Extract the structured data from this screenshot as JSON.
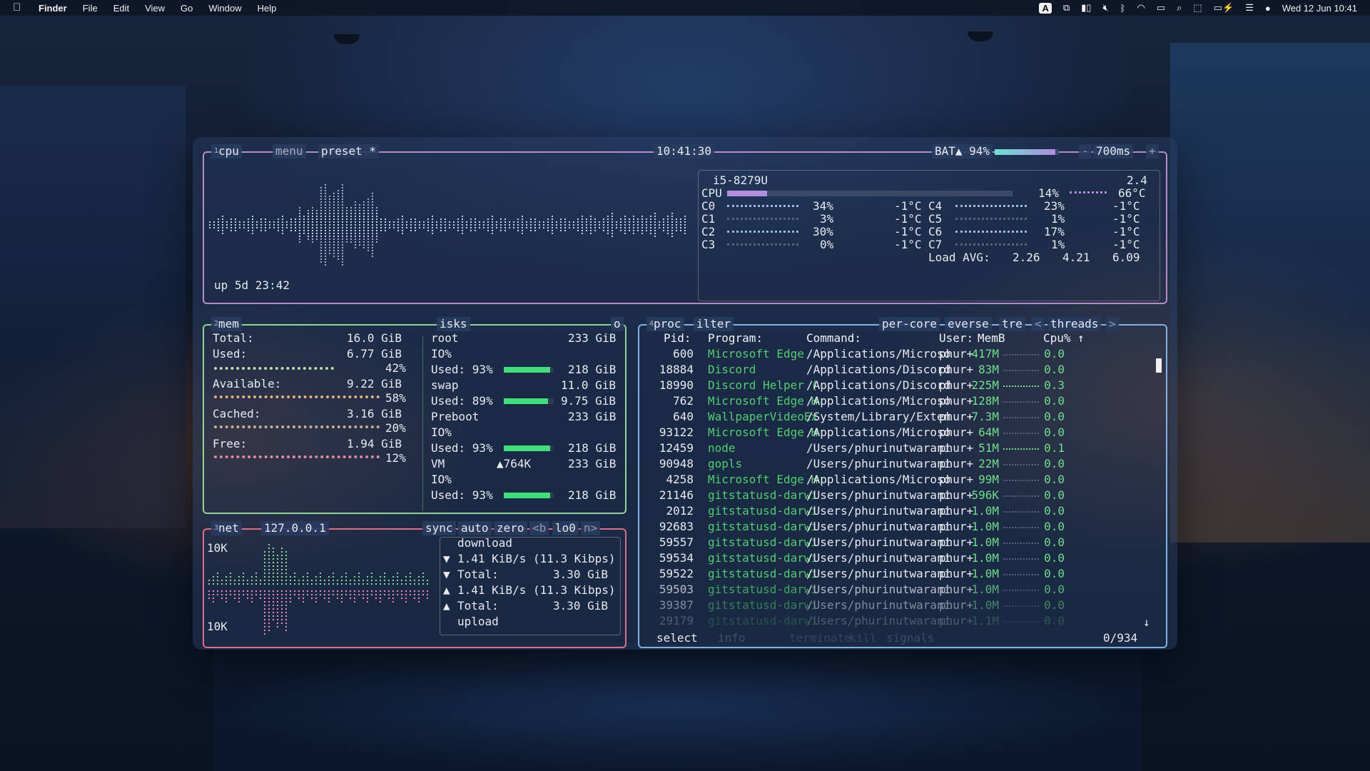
{
  "menubar": {
    "app": "Finder",
    "items": [
      "File",
      "Edit",
      "View",
      "Go",
      "Window",
      "Help"
    ],
    "status_icons": [
      "input-source-a",
      "screen-mirror-icon",
      "sidebar-icon",
      "mute-icon",
      "bluetooth-icon",
      "wifi-icon",
      "display-icon",
      "spotlight-icon",
      "bracket-icon",
      "battery-icon",
      "control-center-icon",
      "siri-icon"
    ],
    "input_source": "A",
    "clock": "Wed 12 Jun  10:41"
  },
  "cpu": {
    "tab_num": "1",
    "label": "cpu",
    "menu": "menu",
    "preset": "preset *",
    "time": "10:41:30",
    "battery": "BAT▲ 94%",
    "battery_pct": 0.94,
    "interval": "700ms",
    "minus": "-",
    "plus": "+",
    "uptime": "up 5d 23:42",
    "model": "i5-8279U",
    "freq": "2.4",
    "cpu_label": "CPU",
    "cpu_pct_text": "14%",
    "cpu_pct": 0.14,
    "cpu_temp": "66°C",
    "cores": [
      {
        "name": "C0",
        "pct": "34%",
        "temp": "-1°C"
      },
      {
        "name": "C1",
        "pct": "3%",
        "temp": "-1°C"
      },
      {
        "name": "C2",
        "pct": "30%",
        "temp": "-1°C"
      },
      {
        "name": "C3",
        "pct": "0%",
        "temp": "-1°C"
      },
      {
        "name": "C4",
        "pct": "23%",
        "temp": "-1°C"
      },
      {
        "name": "C5",
        "pct": "1%",
        "temp": "-1°C"
      },
      {
        "name": "C6",
        "pct": "17%",
        "temp": "-1°C"
      },
      {
        "name": "C7",
        "pct": "1%",
        "temp": "-1°C"
      }
    ],
    "load_label": "Load AVG:",
    "load": [
      "2.26",
      "4.21",
      "6.09"
    ]
  },
  "mem": {
    "tab_num": "2",
    "label": "mem",
    "rows": [
      {
        "label": "Total:",
        "value": "16.0 GiB"
      },
      {
        "label": "Used:",
        "value": "6.77 GiB",
        "pct": "42%"
      },
      {
        "label": "Available:",
        "value": "9.22 GiB",
        "pct": "58%"
      },
      {
        "label": "Cached:",
        "value": "3.16 GiB",
        "pct": "20%"
      },
      {
        "label": "Free:",
        "value": "1.94 GiB",
        "pct": "12%"
      }
    ],
    "used_frac": 0.42,
    "avail_frac": 0.58,
    "cached_frac": 0.2,
    "free_frac": 0.12
  },
  "disks": {
    "label": "isks",
    "io": "o",
    "rows": [
      {
        "name": "root",
        "size": "233 GiB"
      },
      {
        "name": "IO%",
        "size": ""
      },
      {
        "name": "Used: 93%",
        "size": "218 GiB",
        "frac": 0.93
      },
      {
        "name": "swap",
        "size": "11.0 GiB"
      },
      {
        "name": "Used: 89%",
        "size": "9.75 GiB",
        "frac": 0.89
      },
      {
        "name": "Preboot",
        "size": "233 GiB"
      },
      {
        "name": "IO%",
        "size": ""
      },
      {
        "name": "Used: 93%",
        "size": "218 GiB",
        "frac": 0.93
      },
      {
        "name": "VM",
        "extra": "▲764K",
        "size": "233 GiB"
      },
      {
        "name": "IO%",
        "size": ""
      },
      {
        "name": "Used: 93%",
        "size": "218 GiB",
        "frac": 0.93
      }
    ]
  },
  "net": {
    "tab_num": "3",
    "label": "net",
    "iface": "127.0.0.1",
    "sync": "sync",
    "auto": "auto",
    "zero": "zero",
    "prev": "<b",
    "if_name": "lo0",
    "next": "n>",
    "scale_top": "10K",
    "scale_bottom": "10K",
    "download": "download",
    "rows": [
      {
        "arrow": "▼",
        "text": "1.41 KiB/s (11.3 Kibps)"
      },
      {
        "arrow": "▼",
        "text": "Total:",
        "value": "3.30 GiB"
      },
      {
        "arrow": "▲",
        "text": "1.41 KiB/s (11.3 Kibps)"
      },
      {
        "arrow": "▲",
        "text": "Total:",
        "value": "3.30 GiB"
      }
    ],
    "upload": "upload"
  },
  "proc": {
    "tab_num": "4",
    "label": "proc",
    "filter": "ilter",
    "per_core": "per-core",
    "reverse": "everse",
    "tree": "tre",
    "threads": "threads",
    "lt": "<",
    "gt": ">",
    "headers": {
      "pid": "Pid:",
      "program": "Program:",
      "command": "Command:",
      "user": "User:",
      "mem": "MemB",
      "cpu": "Cpu%"
    },
    "up_arrow": "↑",
    "down_arrow": "↓",
    "rows": [
      {
        "pid": "600",
        "program": "Microsoft Edge",
        "command": "/Applications/Microso",
        "user": "phur+",
        "mem": "417M",
        "cpu": "0.0"
      },
      {
        "pid": "18884",
        "program": "Discord",
        "command": "/Applications/Discord",
        "user": "phur+",
        "mem": "83M",
        "cpu": "0.0"
      },
      {
        "pid": "18990",
        "program": "Discord Helper (",
        "command": "/Applications/Discord",
        "user": "phur+",
        "mem": "225M",
        "cpu": "0.3"
      },
      {
        "pid": "762",
        "program": "Microsoft Edge H",
        "command": "/Applications/Microso",
        "user": "phur+",
        "mem": "128M",
        "cpu": "0.0"
      },
      {
        "pid": "640",
        "program": "WallpaperVideoEx",
        "command": "/System/Library/Exten",
        "user": "phur+",
        "mem": "7.3M",
        "cpu": "0.0"
      },
      {
        "pid": "93122",
        "program": "Microsoft Edge H",
        "command": "/Applications/Microso",
        "user": "phur+",
        "mem": "64M",
        "cpu": "0.0"
      },
      {
        "pid": "12459",
        "program": "node",
        "command": "/Users/phurinutwarani",
        "user": "phur+",
        "mem": "51M",
        "cpu": "0.1"
      },
      {
        "pid": "90948",
        "program": "gopls",
        "command": "/Users/phurinutwarani",
        "user": "phur+",
        "mem": "22M",
        "cpu": "0.0"
      },
      {
        "pid": "4258",
        "program": "Microsoft Edge H",
        "command": "/Applications/Microso",
        "user": "phur+",
        "mem": "99M",
        "cpu": "0.0"
      },
      {
        "pid": "21146",
        "program": "gitstatusd-darwi",
        "command": "/Users/phurinutwarani",
        "user": "phur+",
        "mem": "596K",
        "cpu": "0.0"
      },
      {
        "pid": "2012",
        "program": "gitstatusd-darwi",
        "command": "/Users/phurinutwarani",
        "user": "phur+",
        "mem": "1.0M",
        "cpu": "0.0"
      },
      {
        "pid": "92683",
        "program": "gitstatusd-darwi",
        "command": "/Users/phurinutwarani",
        "user": "phur+",
        "mem": "1.0M",
        "cpu": "0.0"
      },
      {
        "pid": "59557",
        "program": "gitstatusd-darwi",
        "command": "/Users/phurinutwarani",
        "user": "phur+",
        "mem": "1.0M",
        "cpu": "0.0"
      },
      {
        "pid": "59534",
        "program": "gitstatusd-darwi",
        "command": "/Users/phurinutwarani",
        "user": "phur+",
        "mem": "1.0M",
        "cpu": "0.0"
      },
      {
        "pid": "59522",
        "program": "gitstatusd-darwi",
        "command": "/Users/phurinutwarani",
        "user": "phur+",
        "mem": "1.0M",
        "cpu": "0.0"
      },
      {
        "pid": "59503",
        "program": "gitstatusd-darwi",
        "command": "/Users/phurinutwarani",
        "user": "phur+",
        "mem": "1.0M",
        "cpu": "0.0"
      },
      {
        "pid": "39387",
        "program": "gitstatusd-darwi",
        "command": "/Users/phurinutwarani",
        "user": "phur+",
        "mem": "1.0M",
        "cpu": "0.0"
      },
      {
        "pid": "29179",
        "program": "gitstatusd-darwi",
        "command": "/Users/phurinutwarani",
        "user": "phur+",
        "mem": "1.1M",
        "cpu": "0.0"
      }
    ],
    "footer": {
      "select": "select",
      "info": "info",
      "terminate": "terminate",
      "kill": "kill",
      "signals": "signals",
      "count": "0/934"
    }
  },
  "colors": {
    "cpu_border": "#b98ac9",
    "mem_border": "#8fd694",
    "net_border": "#e06c8a",
    "proc_border": "#7fb3e6",
    "program_green": "#4fcf70",
    "graph_cpu": "#c8d8f0",
    "graph_net_down": "#8fd694",
    "graph_net_up": "#f08ab5"
  }
}
